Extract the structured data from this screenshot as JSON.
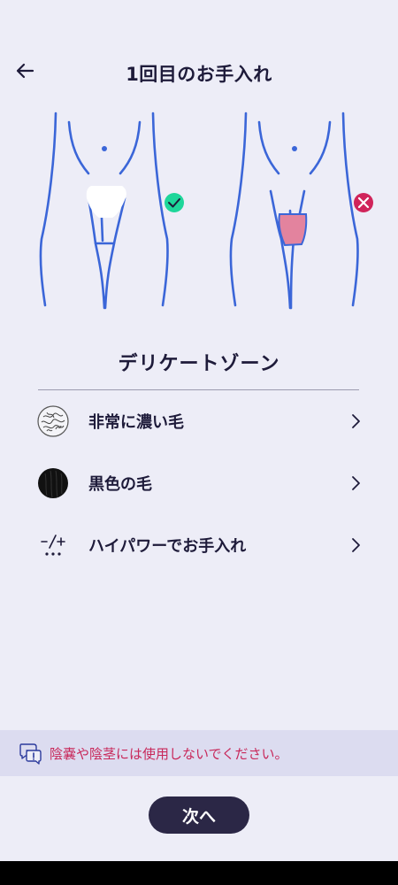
{
  "header": {
    "title": "1回目のお手入れ",
    "back_icon": "arrow-left-icon"
  },
  "illustrations": {
    "ok": {
      "status_icon": "check-icon",
      "status_color": "#1ED69A",
      "zone_fill": "#FFFFFF"
    },
    "ng": {
      "status_icon": "close-icon",
      "status_color": "#D0245A",
      "zone_fill": "#E3839E"
    },
    "line_color": "#3B66D8"
  },
  "zone": {
    "title": "デリケートゾーン"
  },
  "options": [
    {
      "label": "非常に濃い毛",
      "icon": "dense-hair-icon"
    },
    {
      "label": "黒色の毛",
      "icon": "black-hair-icon"
    },
    {
      "label": "ハイパワーでお手入れ",
      "icon": "power-level-icon"
    }
  ],
  "notice": {
    "text": "陰嚢や陰茎には使用しないでください。",
    "icon": "chat-warning-icon",
    "color": "#C8285A"
  },
  "footer": {
    "next_label": "次へ"
  }
}
